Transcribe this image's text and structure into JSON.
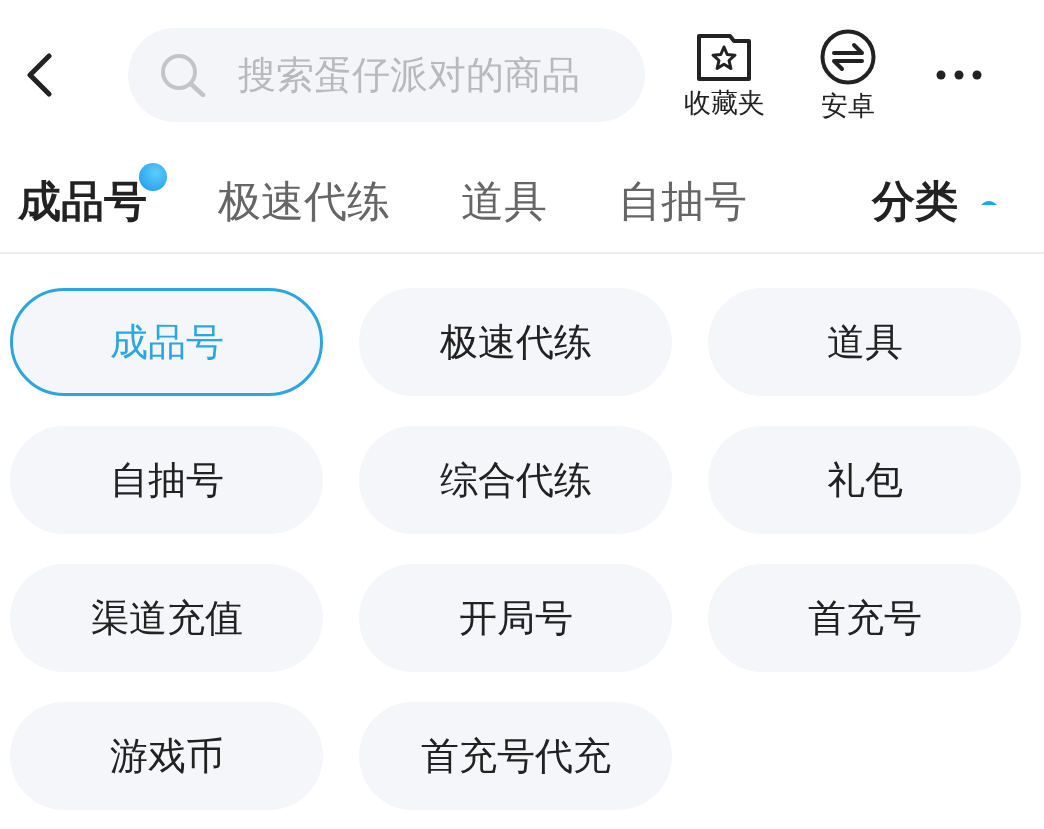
{
  "top_bar": {
    "search": {
      "placeholder": "搜索蛋仔派对的商品"
    },
    "actions": [
      {
        "kind": "favorites",
        "label": "收藏夹"
      },
      {
        "kind": "android",
        "label": "安卓"
      }
    ]
  },
  "tabs": [
    {
      "label": "成品号",
      "selected": true,
      "badge": true
    },
    {
      "label": "极速代练",
      "selected": false,
      "badge": false
    },
    {
      "label": "道具",
      "selected": false,
      "badge": false
    },
    {
      "label": "自抽号",
      "selected": false,
      "badge": false
    }
  ],
  "category_toggle": {
    "label": "分类",
    "expanded": true
  },
  "categories": [
    {
      "label": "成品号",
      "selected": true
    },
    {
      "label": "极速代练",
      "selected": false
    },
    {
      "label": "道具",
      "selected": false
    },
    {
      "label": "自抽号",
      "selected": false
    },
    {
      "label": "综合代练",
      "selected": false
    },
    {
      "label": "礼包",
      "selected": false
    },
    {
      "label": "渠道充值",
      "selected": false
    },
    {
      "label": "开局号",
      "selected": false
    },
    {
      "label": "首充号",
      "selected": false
    },
    {
      "label": "游戏币",
      "selected": false
    },
    {
      "label": "首充号代充",
      "selected": false
    }
  ]
}
